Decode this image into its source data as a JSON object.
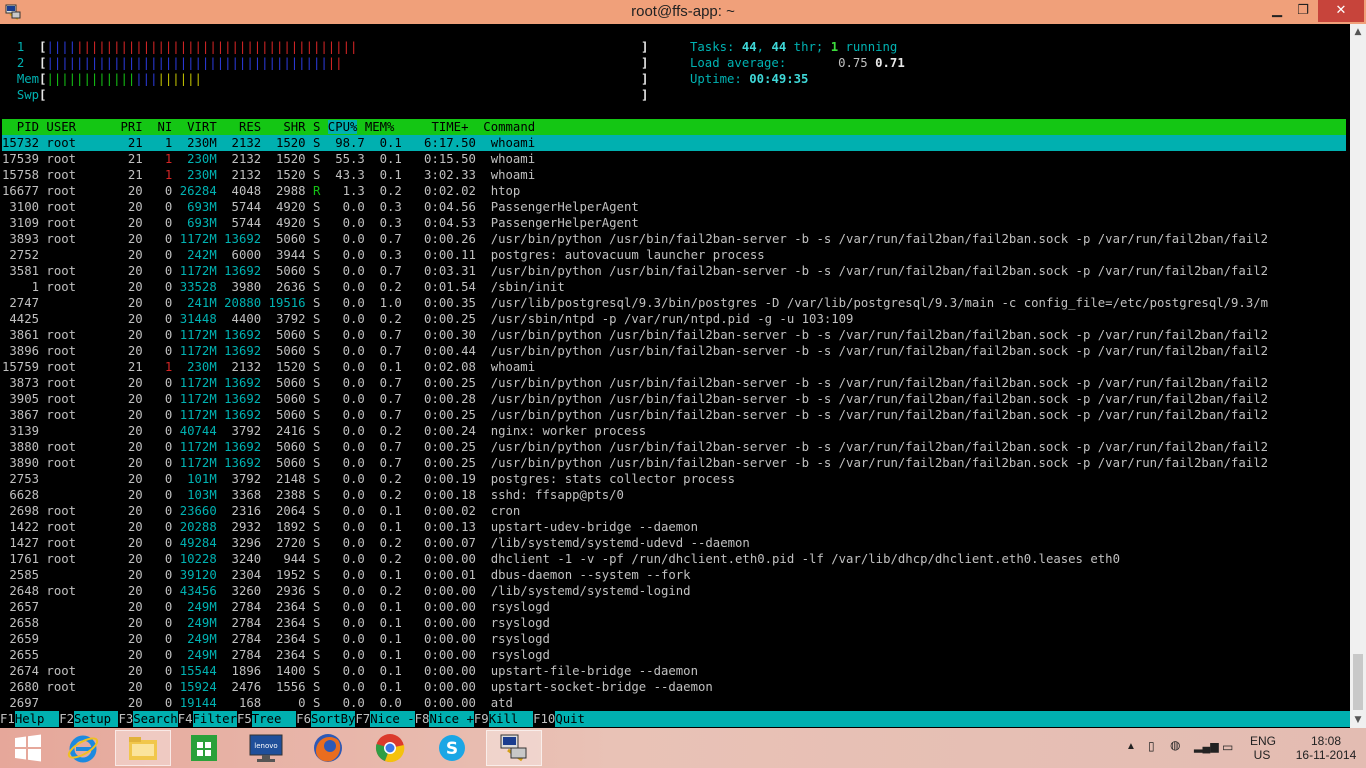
{
  "window": {
    "title": "root@ffs-app: ~"
  },
  "meters": {
    "cpu1_label": "1",
    "cpu1_bar_blue": "||||",
    "cpu1_bar_red": "||||||||||||||||||||||||||||||||||||||",
    "cpu1_bar_blue_fraction": 0.1,
    "cpu1_bar_red_fraction": 0.9,
    "cpu2_label": "2",
    "cpu2_bar_blue": "||||||||||||||||||||||||||||||||||||||",
    "cpu2_bar_red": "||",
    "cpu2_bar_blue_fraction": 0.94,
    "cpu2_bar_red_fraction": 0.06,
    "mem_label": "Mem",
    "mem_bar_green": "||||||||||||",
    "mem_bar_blue": "|||",
    "mem_bar_yellow": "||||||",
    "mem_bar_green_fraction": 0.14,
    "mem_bar_blue_fraction": 0.04,
    "mem_bar_yellow_fraction": 0.07,
    "swp_label": "Swp"
  },
  "summary": {
    "tasks_label": "Tasks: ",
    "tasks_value": "44",
    "thr_value": "44",
    "thr_label": " thr; ",
    "running_value": "1",
    "running_label": " running",
    "load_label": "Load average: ",
    "load1": "0.75",
    "load5": "0.71",
    "uptime_label": "Uptime: ",
    "uptime_value": "00:49:35"
  },
  "columns": {
    "pid": "PID",
    "user": "USER",
    "pri": "PRI",
    "ni": "NI",
    "virt": "VIRT",
    "res": "RES",
    "shr": "SHR",
    "s": "S",
    "cpu": "CPU%",
    "mem": "MEM%",
    "time": "TIME+",
    "command": "Command"
  },
  "processes": [
    {
      "pid": "15732",
      "user": "root",
      "pri": "21",
      "ni": "1",
      "virt": "230M",
      "res": "2132",
      "shr": "1520",
      "s": "S",
      "cpu": "98.7",
      "mem": "0.1",
      "time": "6:17.50",
      "cmd": "whoami"
    },
    {
      "pid": "17539",
      "user": "root",
      "pri": "21",
      "ni": "1",
      "virt": "230M",
      "res": "2132",
      "shr": "1520",
      "s": "S",
      "cpu": "55.3",
      "mem": "0.1",
      "time": "0:15.50",
      "cmd": "whoami"
    },
    {
      "pid": "15758",
      "user": "root",
      "pri": "21",
      "ni": "1",
      "virt": "230M",
      "res": "2132",
      "shr": "1520",
      "s": "S",
      "cpu": "43.3",
      "mem": "0.1",
      "time": "3:02.33",
      "cmd": "whoami"
    },
    {
      "pid": "16677",
      "user": "root",
      "pri": "20",
      "ni": "0",
      "virt": "26284",
      "res": "4048",
      "shr": "2988",
      "s": "R",
      "cpu": "1.3",
      "mem": "0.2",
      "time": "0:02.02",
      "cmd": "htop"
    },
    {
      "pid": "3100",
      "user": "root",
      "pri": "20",
      "ni": "0",
      "virt": "693M",
      "res": "5744",
      "shr": "4920",
      "s": "S",
      "cpu": "0.0",
      "mem": "0.3",
      "time": "0:04.56",
      "cmd": "PassengerHelperAgent"
    },
    {
      "pid": "3109",
      "user": "root",
      "pri": "20",
      "ni": "0",
      "virt": "693M",
      "res": "5744",
      "shr": "4920",
      "s": "S",
      "cpu": "0.0",
      "mem": "0.3",
      "time": "0:04.53",
      "cmd": "PassengerHelperAgent"
    },
    {
      "pid": "3893",
      "user": "root",
      "pri": "20",
      "ni": "0",
      "virt": "1172M",
      "res": "13692",
      "shr": "5060",
      "s": "S",
      "cpu": "0.0",
      "mem": "0.7",
      "time": "0:00.26",
      "cmd": "/usr/bin/python /usr/bin/fail2ban-server -b -s /var/run/fail2ban/fail2ban.sock -p /var/run/fail2ban/fail2"
    },
    {
      "pid": "2752",
      "user": "",
      "pri": "20",
      "ni": "0",
      "virt": "242M",
      "res": "6000",
      "shr": "3944",
      "s": "S",
      "cpu": "0.0",
      "mem": "0.3",
      "time": "0:00.11",
      "cmd": "postgres: autovacuum launcher process"
    },
    {
      "pid": "3581",
      "user": "root",
      "pri": "20",
      "ni": "0",
      "virt": "1172M",
      "res": "13692",
      "shr": "5060",
      "s": "S",
      "cpu": "0.0",
      "mem": "0.7",
      "time": "0:03.31",
      "cmd": "/usr/bin/python /usr/bin/fail2ban-server -b -s /var/run/fail2ban/fail2ban.sock -p /var/run/fail2ban/fail2"
    },
    {
      "pid": "1",
      "user": "root",
      "pri": "20",
      "ni": "0",
      "virt": "33528",
      "res": "3980",
      "shr": "2636",
      "s": "S",
      "cpu": "0.0",
      "mem": "0.2",
      "time": "0:01.54",
      "cmd": "/sbin/init"
    },
    {
      "pid": "2747",
      "user": "",
      "pri": "20",
      "ni": "0",
      "virt": "241M",
      "res": "20880",
      "shr": "19516",
      "s": "S",
      "cpu": "0.0",
      "mem": "1.0",
      "time": "0:00.35",
      "cmd": "/usr/lib/postgresql/9.3/bin/postgres -D /var/lib/postgresql/9.3/main -c config_file=/etc/postgresql/9.3/m"
    },
    {
      "pid": "4425",
      "user": "",
      "pri": "20",
      "ni": "0",
      "virt": "31448",
      "res": "4400",
      "shr": "3792",
      "s": "S",
      "cpu": "0.0",
      "mem": "0.2",
      "time": "0:00.25",
      "cmd": "/usr/sbin/ntpd -p /var/run/ntpd.pid -g -u 103:109"
    },
    {
      "pid": "3861",
      "user": "root",
      "pri": "20",
      "ni": "0",
      "virt": "1172M",
      "res": "13692",
      "shr": "5060",
      "s": "S",
      "cpu": "0.0",
      "mem": "0.7",
      "time": "0:00.30",
      "cmd": "/usr/bin/python /usr/bin/fail2ban-server -b -s /var/run/fail2ban/fail2ban.sock -p /var/run/fail2ban/fail2"
    },
    {
      "pid": "3896",
      "user": "root",
      "pri": "20",
      "ni": "0",
      "virt": "1172M",
      "res": "13692",
      "shr": "5060",
      "s": "S",
      "cpu": "0.0",
      "mem": "0.7",
      "time": "0:00.44",
      "cmd": "/usr/bin/python /usr/bin/fail2ban-server -b -s /var/run/fail2ban/fail2ban.sock -p /var/run/fail2ban/fail2"
    },
    {
      "pid": "15759",
      "user": "root",
      "pri": "21",
      "ni": "1",
      "virt": "230M",
      "res": "2132",
      "shr": "1520",
      "s": "S",
      "cpu": "0.0",
      "mem": "0.1",
      "time": "0:02.08",
      "cmd": "whoami"
    },
    {
      "pid": "3873",
      "user": "root",
      "pri": "20",
      "ni": "0",
      "virt": "1172M",
      "res": "13692",
      "shr": "5060",
      "s": "S",
      "cpu": "0.0",
      "mem": "0.7",
      "time": "0:00.25",
      "cmd": "/usr/bin/python /usr/bin/fail2ban-server -b -s /var/run/fail2ban/fail2ban.sock -p /var/run/fail2ban/fail2"
    },
    {
      "pid": "3905",
      "user": "root",
      "pri": "20",
      "ni": "0",
      "virt": "1172M",
      "res": "13692",
      "shr": "5060",
      "s": "S",
      "cpu": "0.0",
      "mem": "0.7",
      "time": "0:00.28",
      "cmd": "/usr/bin/python /usr/bin/fail2ban-server -b -s /var/run/fail2ban/fail2ban.sock -p /var/run/fail2ban/fail2"
    },
    {
      "pid": "3867",
      "user": "root",
      "pri": "20",
      "ni": "0",
      "virt": "1172M",
      "res": "13692",
      "shr": "5060",
      "s": "S",
      "cpu": "0.0",
      "mem": "0.7",
      "time": "0:00.25",
      "cmd": "/usr/bin/python /usr/bin/fail2ban-server -b -s /var/run/fail2ban/fail2ban.sock -p /var/run/fail2ban/fail2"
    },
    {
      "pid": "3139",
      "user": "",
      "pri": "20",
      "ni": "0",
      "virt": "40744",
      "res": "3792",
      "shr": "2416",
      "s": "S",
      "cpu": "0.0",
      "mem": "0.2",
      "time": "0:00.24",
      "cmd": "nginx: worker process"
    },
    {
      "pid": "3880",
      "user": "root",
      "pri": "20",
      "ni": "0",
      "virt": "1172M",
      "res": "13692",
      "shr": "5060",
      "s": "S",
      "cpu": "0.0",
      "mem": "0.7",
      "time": "0:00.25",
      "cmd": "/usr/bin/python /usr/bin/fail2ban-server -b -s /var/run/fail2ban/fail2ban.sock -p /var/run/fail2ban/fail2"
    },
    {
      "pid": "3890",
      "user": "root",
      "pri": "20",
      "ni": "0",
      "virt": "1172M",
      "res": "13692",
      "shr": "5060",
      "s": "S",
      "cpu": "0.0",
      "mem": "0.7",
      "time": "0:00.25",
      "cmd": "/usr/bin/python /usr/bin/fail2ban-server -b -s /var/run/fail2ban/fail2ban.sock -p /var/run/fail2ban/fail2"
    },
    {
      "pid": "2753",
      "user": "",
      "pri": "20",
      "ni": "0",
      "virt": "101M",
      "res": "3792",
      "shr": "2148",
      "s": "S",
      "cpu": "0.0",
      "mem": "0.2",
      "time": "0:00.19",
      "cmd": "postgres: stats collector process"
    },
    {
      "pid": "6628",
      "user": "",
      "pri": "20",
      "ni": "0",
      "virt": "103M",
      "res": "3368",
      "shr": "2388",
      "s": "S",
      "cpu": "0.0",
      "mem": "0.2",
      "time": "0:00.18",
      "cmd": "sshd: ffsapp@pts/0"
    },
    {
      "pid": "2698",
      "user": "root",
      "pri": "20",
      "ni": "0",
      "virt": "23660",
      "res": "2316",
      "shr": "2064",
      "s": "S",
      "cpu": "0.0",
      "mem": "0.1",
      "time": "0:00.02",
      "cmd": "cron"
    },
    {
      "pid": "1422",
      "user": "root",
      "pri": "20",
      "ni": "0",
      "virt": "20288",
      "res": "2932",
      "shr": "1892",
      "s": "S",
      "cpu": "0.0",
      "mem": "0.1",
      "time": "0:00.13",
      "cmd": "upstart-udev-bridge --daemon"
    },
    {
      "pid": "1427",
      "user": "root",
      "pri": "20",
      "ni": "0",
      "virt": "49284",
      "res": "3296",
      "shr": "2720",
      "s": "S",
      "cpu": "0.0",
      "mem": "0.2",
      "time": "0:00.07",
      "cmd": "/lib/systemd/systemd-udevd --daemon"
    },
    {
      "pid": "1761",
      "user": "root",
      "pri": "20",
      "ni": "0",
      "virt": "10228",
      "res": "3240",
      "shr": "944",
      "s": "S",
      "cpu": "0.0",
      "mem": "0.2",
      "time": "0:00.00",
      "cmd": "dhclient -1 -v -pf /run/dhclient.eth0.pid -lf /var/lib/dhcp/dhclient.eth0.leases eth0"
    },
    {
      "pid": "2585",
      "user": "",
      "pri": "20",
      "ni": "0",
      "virt": "39120",
      "res": "2304",
      "shr": "1952",
      "s": "S",
      "cpu": "0.0",
      "mem": "0.1",
      "time": "0:00.01",
      "cmd": "dbus-daemon --system --fork"
    },
    {
      "pid": "2648",
      "user": "root",
      "pri": "20",
      "ni": "0",
      "virt": "43456",
      "res": "3260",
      "shr": "2936",
      "s": "S",
      "cpu": "0.0",
      "mem": "0.2",
      "time": "0:00.00",
      "cmd": "/lib/systemd/systemd-logind"
    },
    {
      "pid": "2657",
      "user": "",
      "pri": "20",
      "ni": "0",
      "virt": "249M",
      "res": "2784",
      "shr": "2364",
      "s": "S",
      "cpu": "0.0",
      "mem": "0.1",
      "time": "0:00.00",
      "cmd": "rsyslogd"
    },
    {
      "pid": "2658",
      "user": "",
      "pri": "20",
      "ni": "0",
      "virt": "249M",
      "res": "2784",
      "shr": "2364",
      "s": "S",
      "cpu": "0.0",
      "mem": "0.1",
      "time": "0:00.00",
      "cmd": "rsyslogd"
    },
    {
      "pid": "2659",
      "user": "",
      "pri": "20",
      "ni": "0",
      "virt": "249M",
      "res": "2784",
      "shr": "2364",
      "s": "S",
      "cpu": "0.0",
      "mem": "0.1",
      "time": "0:00.00",
      "cmd": "rsyslogd"
    },
    {
      "pid": "2655",
      "user": "",
      "pri": "20",
      "ni": "0",
      "virt": "249M",
      "res": "2784",
      "shr": "2364",
      "s": "S",
      "cpu": "0.0",
      "mem": "0.1",
      "time": "0:00.00",
      "cmd": "rsyslogd"
    },
    {
      "pid": "2674",
      "user": "root",
      "pri": "20",
      "ni": "0",
      "virt": "15544",
      "res": "1896",
      "shr": "1400",
      "s": "S",
      "cpu": "0.0",
      "mem": "0.1",
      "time": "0:00.00",
      "cmd": "upstart-file-bridge --daemon"
    },
    {
      "pid": "2680",
      "user": "root",
      "pri": "20",
      "ni": "0",
      "virt": "15924",
      "res": "2476",
      "shr": "1556",
      "s": "S",
      "cpu": "0.0",
      "mem": "0.1",
      "time": "0:00.00",
      "cmd": "upstart-socket-bridge --daemon"
    },
    {
      "pid": "2697",
      "user": "",
      "pri": "20",
      "ni": "0",
      "virt": "19144",
      "res": "168",
      "shr": "0",
      "s": "S",
      "cpu": "0.0",
      "mem": "0.0",
      "time": "0:00.00",
      "cmd": "atd"
    }
  ],
  "fkeys": [
    {
      "key": "F1",
      "label": "Help  "
    },
    {
      "key": "F2",
      "label": "Setup "
    },
    {
      "key": "F3",
      "label": "Search"
    },
    {
      "key": "F4",
      "label": "Filter"
    },
    {
      "key": "F5",
      "label": "Tree  "
    },
    {
      "key": "F6",
      "label": "SortBy"
    },
    {
      "key": "F7",
      "label": "Nice -"
    },
    {
      "key": "F8",
      "label": "Nice +"
    },
    {
      "key": "F9",
      "label": "Kill  "
    },
    {
      "key": "F10",
      "label": "Quit"
    }
  ],
  "taskbar": {
    "apps": [
      "windows-start-icon",
      "internet-explorer-icon",
      "file-explorer-icon",
      "store-icon",
      "lenovo-icon",
      "firefox-icon",
      "chrome-icon",
      "skype-icon",
      "putty-icon"
    ],
    "lenovo_text": "lenovo",
    "lang_top": "ENG",
    "lang_bottom": "US",
    "time": "18:08",
    "date": "16-11-2014"
  },
  "colors": {
    "title_bar": "#f0a07a",
    "header_green": "#14c614",
    "selection_cyan": "#00b0b0",
    "close_red": "#c7443b"
  }
}
